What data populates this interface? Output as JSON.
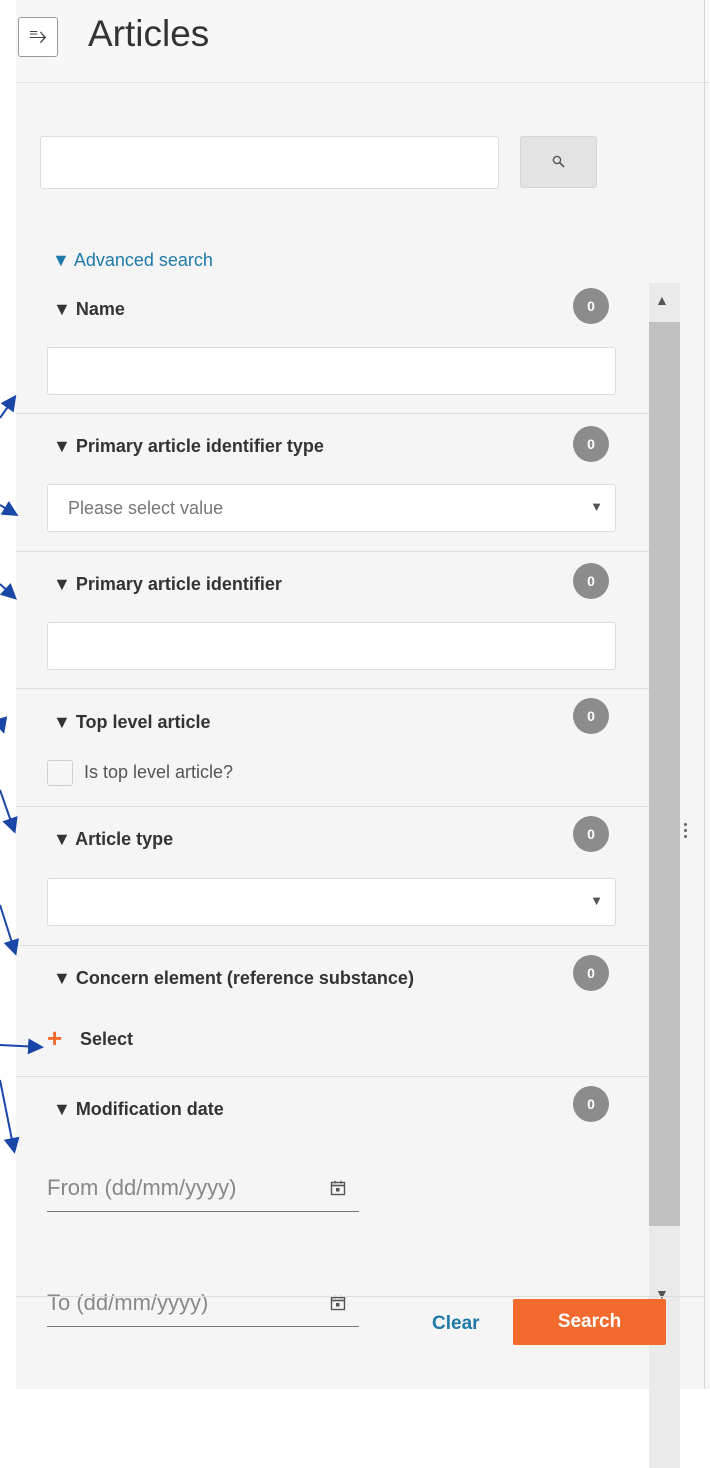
{
  "header": {
    "menu_icon": "menu-collapse-icon",
    "title": "Articles"
  },
  "search": {
    "value": "",
    "placeholder": "",
    "button_icon": "search-icon"
  },
  "advanced_search": {
    "label": "▼ Advanced search",
    "expanded": true
  },
  "filters": [
    {
      "id": "name",
      "title": "▼ Name",
      "count": "0",
      "type": "text",
      "value": ""
    },
    {
      "id": "primary-article-identifier-type",
      "title": "▼ Primary article identifier type",
      "count": "0",
      "type": "select",
      "value": "Please select value"
    },
    {
      "id": "primary-article-identifier",
      "title": "▼ Primary article identifier",
      "count": "0",
      "type": "text",
      "value": ""
    },
    {
      "id": "top-level-article",
      "title": "▼ Top level article",
      "count": "0",
      "type": "checkbox",
      "checkbox_label": "Is top level article?",
      "checked": false
    },
    {
      "id": "article-type",
      "title": "▼ Article type",
      "count": "0",
      "type": "select",
      "value": ""
    },
    {
      "id": "concern-element",
      "title": "▼ Concern element (reference substance)",
      "count": "0",
      "type": "picker",
      "select_label": "Select"
    },
    {
      "id": "modification-date",
      "title": "▼ Modification date",
      "count": "0",
      "type": "daterange",
      "from_placeholder": "From (dd/mm/yyyy)",
      "to_placeholder": "To (dd/mm/yyyy)"
    }
  ],
  "footer": {
    "clear_label": "Clear",
    "search_label": "Search"
  },
  "colors": {
    "accent_orange": "#f26a2e",
    "link_blue": "#1f7aa8",
    "badge_gray": "#8c8c8c",
    "annotation_arrow": "#1a46a8"
  }
}
